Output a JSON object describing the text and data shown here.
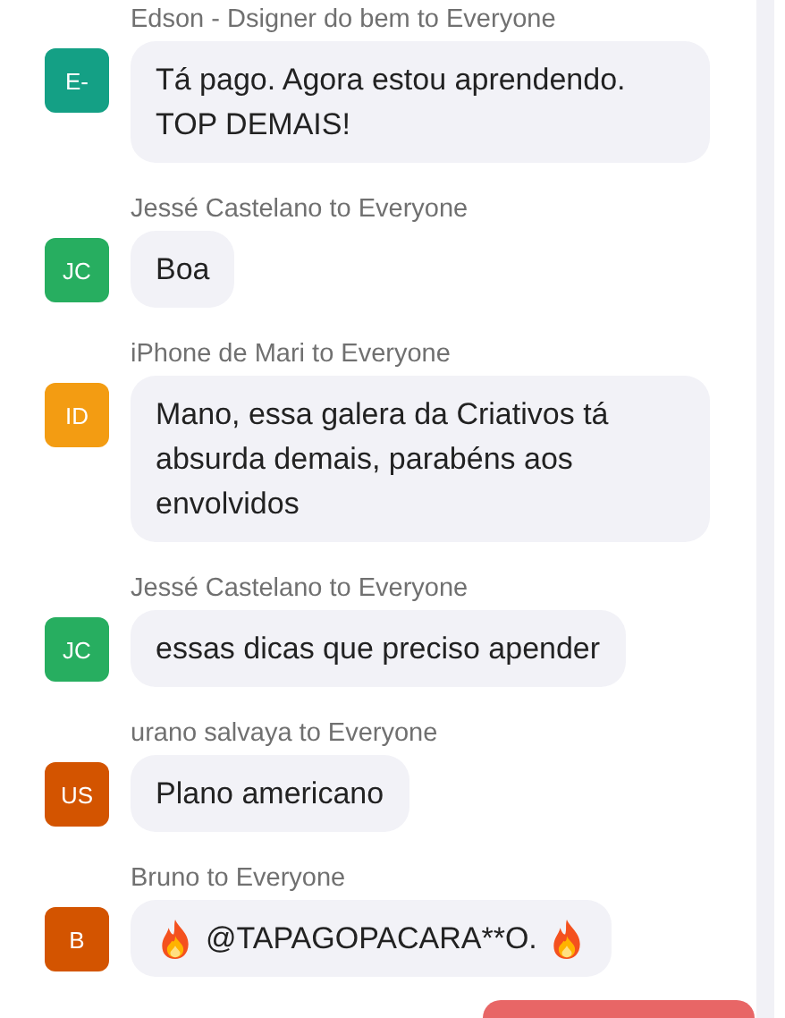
{
  "messages": [
    {
      "sender": "Edson - Dsigner do bem to Everyone",
      "initials": "E-",
      "color": "#14a085",
      "parts": [
        {
          "kind": "text",
          "text": "Tá pago. Agora estou aprendendo. TOP DEMAIS!"
        }
      ]
    },
    {
      "sender": "Jessé Castelano to Everyone",
      "initials": "JC",
      "color": "#27ae60",
      "parts": [
        {
          "kind": "text",
          "text": "Boa"
        }
      ]
    },
    {
      "sender": "iPhone de Mari to Everyone",
      "initials": "ID",
      "color": "#f39c12",
      "parts": [
        {
          "kind": "text",
          "text": "Mano, essa galera da Criativos tá absurda demais, parabéns aos envolvidos"
        }
      ]
    },
    {
      "sender": "Jessé Castelano to Everyone",
      "initials": "JC",
      "color": "#27ae60",
      "parts": [
        {
          "kind": "text",
          "text": "essas dicas que preciso apender"
        }
      ]
    },
    {
      "sender": "urano salvaya to Everyone",
      "initials": "US",
      "color": "#d35400",
      "parts": [
        {
          "kind": "text",
          "text": "Plano americano"
        }
      ]
    },
    {
      "sender": "Bruno to Everyone",
      "initials": "B",
      "color": "#d35400",
      "parts": [
        {
          "kind": "fire"
        },
        {
          "kind": "text",
          "text": "@TAPAGOPACARA**O."
        },
        {
          "kind": "fire"
        }
      ]
    }
  ]
}
